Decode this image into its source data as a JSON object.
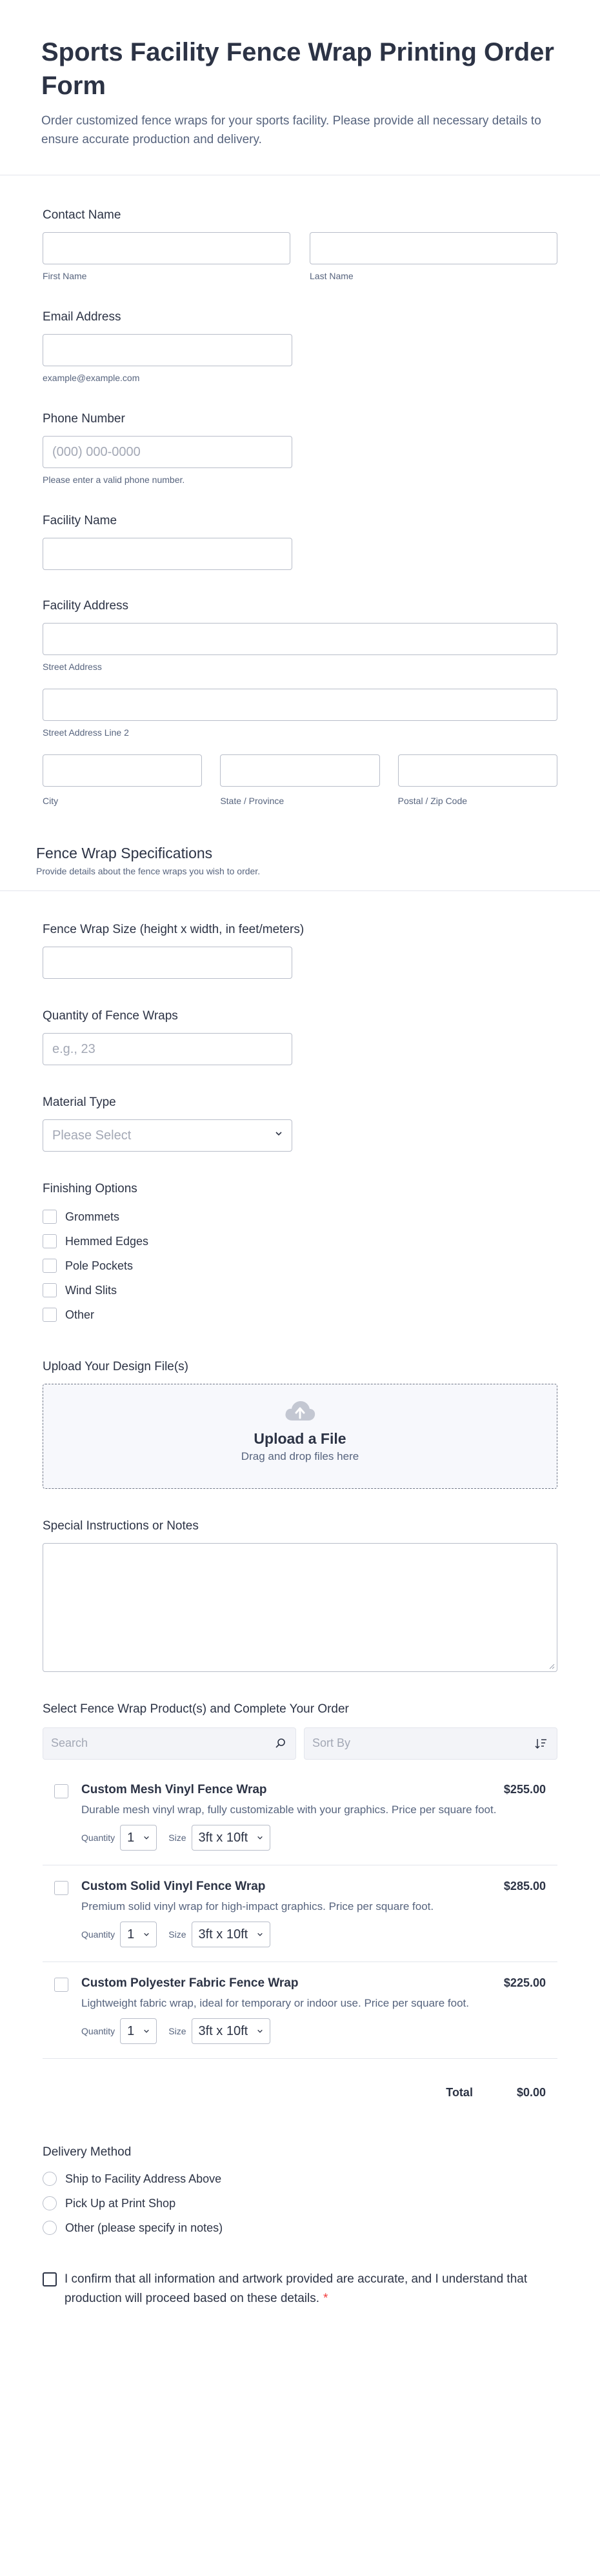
{
  "header": {
    "title": "Sports Facility Fence Wrap Printing Order Form",
    "description": "Order customized fence wraps for your sports facility. Please provide all necessary details to ensure accurate production and delivery."
  },
  "contact": {
    "label": "Contact Name",
    "first_sub": "First Name",
    "last_sub": "Last Name"
  },
  "email": {
    "label": "Email Address",
    "sub": "example@example.com"
  },
  "phone": {
    "label": "Phone Number",
    "placeholder": "(000) 000-0000",
    "sub": "Please enter a valid phone number."
  },
  "facility_name": {
    "label": "Facility Name"
  },
  "address": {
    "label": "Facility Address",
    "street_sub": "Street Address",
    "street2_sub": "Street Address Line 2",
    "city_sub": "City",
    "state_sub": "State / Province",
    "zip_sub": "Postal / Zip Code"
  },
  "specs": {
    "title": "Fence Wrap Specifications",
    "subtitle": "Provide details about the fence wraps you wish to order."
  },
  "size": {
    "label": "Fence Wrap Size (height x width, in feet/meters)"
  },
  "quantity": {
    "label": "Quantity of Fence Wraps",
    "placeholder": "e.g., 23"
  },
  "material": {
    "label": "Material Type",
    "placeholder": "Please Select"
  },
  "finishing": {
    "label": "Finishing Options",
    "options": [
      "Grommets",
      "Hemmed Edges",
      "Pole Pockets",
      "Wind Slits",
      "Other"
    ]
  },
  "upload": {
    "label": "Upload Your Design File(s)",
    "title": "Upload a File",
    "sub": "Drag and drop files here"
  },
  "notes": {
    "label": "Special Instructions or Notes"
  },
  "products": {
    "label": "Select Fence Wrap Product(s) and Complete Your Order",
    "search_placeholder": "Search",
    "sort_placeholder": "Sort By",
    "quantity_label": "Quantity",
    "size_label": "Size",
    "items": [
      {
        "name": "Custom Mesh Vinyl Fence Wrap",
        "price": "$255.00",
        "desc": "Durable mesh vinyl wrap, fully customizable with your graphics. Price per square foot.",
        "qty": "1",
        "size": "3ft x 10ft"
      },
      {
        "name": "Custom Solid Vinyl Fence Wrap",
        "price": "$285.00",
        "desc": "Premium solid vinyl wrap for high-impact graphics. Price per square foot.",
        "qty": "1",
        "size": "3ft x 10ft"
      },
      {
        "name": "Custom Polyester Fabric Fence Wrap",
        "price": "$225.00",
        "desc": "Lightweight fabric wrap, ideal for temporary or indoor use. Price per square foot.",
        "qty": "1",
        "size": "3ft x 10ft"
      }
    ],
    "total_label": "Total",
    "total_value": "$0.00"
  },
  "delivery": {
    "label": "Delivery Method",
    "options": [
      "Ship to Facility Address Above",
      "Pick Up at Print Shop",
      "Other (please specify in notes)"
    ]
  },
  "consent": {
    "text": "I confirm that all information and artwork provided are accurate, and I understand that production will proceed based on these details.",
    "required_mark": "*"
  },
  "colors": {
    "text": "#2c3345",
    "muted": "#57647e",
    "border": "#b8bdc9",
    "required": "#f23a3c"
  }
}
